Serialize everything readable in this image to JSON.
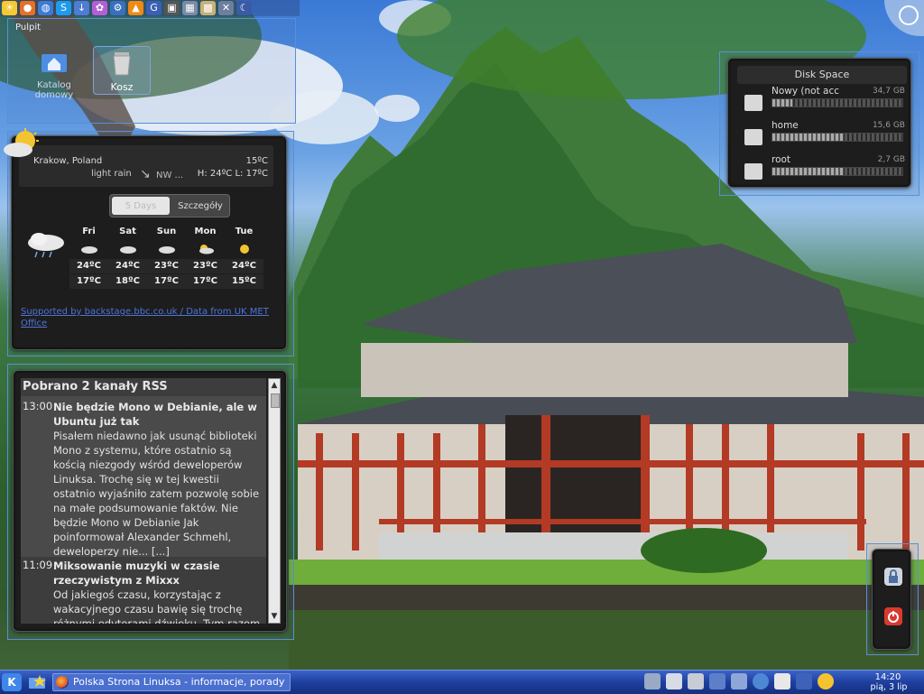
{
  "desktop_folder": {
    "title": "Pulpit",
    "icons": [
      {
        "label": "Katalog domowy",
        "icon": "home-folder-icon"
      },
      {
        "label": "Kosz",
        "icon": "trash-icon"
      }
    ]
  },
  "weather": {
    "location": "Krakow, Poland",
    "current_temp": "15ºC",
    "condition": "light rain",
    "wind": "NW ...",
    "hi_lo": "H: 24ºC L: 17ºC",
    "tabs": [
      "5 Days",
      "Szczegóły"
    ],
    "active_tab": "5 Days",
    "forecast": [
      {
        "day": "Fri",
        "icon": "cloud-icon",
        "hi": "24ºC",
        "lo": "17ºC"
      },
      {
        "day": "Sat",
        "icon": "cloud-icon",
        "hi": "24ºC",
        "lo": "18ºC"
      },
      {
        "day": "Sun",
        "icon": "cloud-icon",
        "hi": "23ºC",
        "lo": "17ºC"
      },
      {
        "day": "Mon",
        "icon": "sun-cloud-icon",
        "hi": "23ºC",
        "lo": "17ºC"
      },
      {
        "day": "Tue",
        "icon": "sun-icon",
        "hi": "24ºC",
        "lo": "15ºC"
      }
    ],
    "credit": "Supported by backstage.bbc.co.uk / Data from UK MET Office"
  },
  "rss": {
    "header": "Pobrano 2 kanały RSS",
    "items": [
      {
        "time": "13:00",
        "title": "Nie będzie Mono w Debianie, ale w Ubuntu już tak",
        "body": "Pisałem niedawno jak usunąć biblioteki Mono z systemu, które ostatnio są kością niezgody wśród deweloperów Linuksa. Trochę się w tej kwestii ostatnio wyjaśniło zatem pozwolę sobie na małe podsumowanie faktów. Nie będzie Mono w Debianie Jak poinformował Alexander Schmehl, deweloperzy nie... [...]"
      },
      {
        "time": "11:09",
        "title": "Miksowanie muzyki w czasie rzeczywistym z Mixxx",
        "body": "Od jakiegoś czasu, korzystając z wakacyjnego czasu bawię się trochę różnymi edytorami dźwięku. Tym razem"
      }
    ]
  },
  "disk_space": {
    "title": "Disk Space",
    "disks": [
      {
        "name": "Nowy (not acc",
        "size": "34,7 GB",
        "used_fraction": 0.15
      },
      {
        "name": "home",
        "size": "15,6 GB",
        "used_fraction": 0.55
      },
      {
        "name": "root",
        "size": "2,7 GB",
        "used_fraction": 0.55
      }
    ]
  },
  "taskbar": {
    "start_label": "K",
    "task_title": "Polska Strona Linuksa - informacje, porady",
    "clock_time": "14:20",
    "clock_date": "pią, 3 lip",
    "tray_icons": [
      "network-icon",
      "clipboard-icon",
      "usb-icon",
      "menu-icon",
      "volume-icon",
      "globe-icon",
      "notes-icon",
      "google-icon",
      "weather-sun-icon"
    ]
  },
  "quick_launch": [
    "kde-icon",
    "firefox-icon",
    "globe-icon",
    "skype-icon",
    "download-icon",
    "pidgin-icon",
    "network-icon",
    "vlc-icon",
    "terminal-icon",
    "calculator-icon",
    "package-icon",
    "tools-icon",
    "moon-icon"
  ]
}
